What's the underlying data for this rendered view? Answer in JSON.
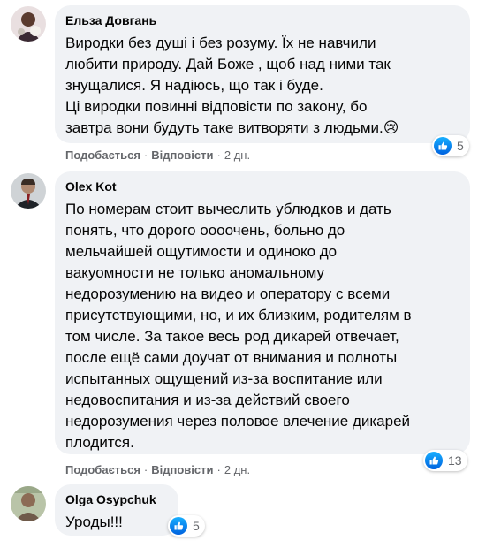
{
  "comments": [
    {
      "author": "Ельза Довгань",
      "text": "Виродки без душі і без розуму. Їх не навчили\nлюбити природу. Дай Боже , щоб над ними так\nзнущалися. Я надіюсь, що так і буде.\nЦі виродки повинні відповісти по закону, бо\nзавтра вони будуть таке витворяти з людьми.",
      "emoji": "😢",
      "like_label": "Подобається",
      "reply_label": "Відповісти",
      "time": "2 дн.",
      "reaction_count": "5",
      "reaction_icon": "like-icon"
    },
    {
      "author": "Olex Kot",
      "text": "По номерам стоит вычеслить ублюдков и дать\nпонять, что дорого оооочень, больно до\nмельчайшей ощутимости и одиноко до\nвакуомности не только аномальному\nнедорозумению на видео и оператору с всеми\nприсутствующими, но, и их близким, родителям в\nтом числе. За такое весь род дикарей отвечает,\nпосле ещё сами доучат от внимания и полноты\nиспытанных ощущений из-за воспитание или\nнедовоспитания и из-за действий своего\nнедорозумения через половое влечение дикарей\nплодится.",
      "like_label": "Подобається",
      "reply_label": "Відповісти",
      "time": "2 дн.",
      "reaction_count": "13",
      "reaction_icon": "like-icon"
    },
    {
      "author": "Olga Osypchuk",
      "text": "Уроды!!!",
      "reaction_count": "5",
      "reaction_icon": "like-icon"
    }
  ],
  "colors": {
    "bubble": "#f0f2f5",
    "meta_text": "#65676b",
    "like_blue": "#0866ff"
  }
}
